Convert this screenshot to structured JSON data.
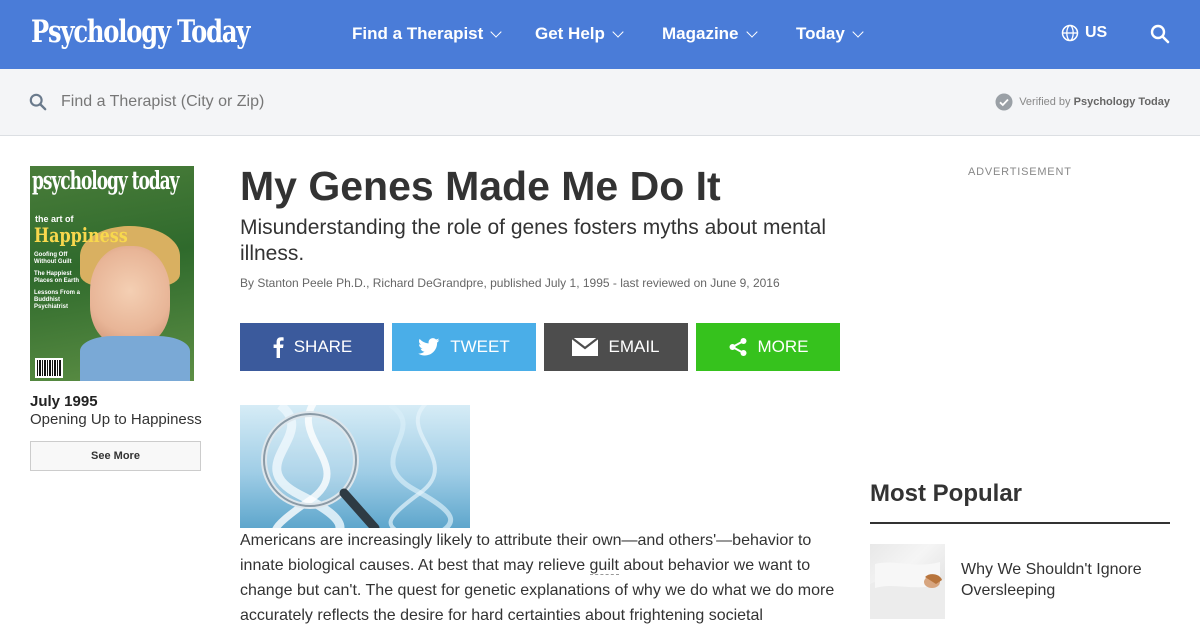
{
  "site": {
    "logo": "Psychology Today",
    "nav": [
      {
        "label": "Find a Therapist"
      },
      {
        "label": "Get Help"
      },
      {
        "label": "Magazine"
      },
      {
        "label": "Today"
      }
    ],
    "region": "US"
  },
  "search": {
    "placeholder": "Find a Therapist (City or Zip)",
    "verified_prefix": "Verified by",
    "verified_by": "Psychology Today"
  },
  "issue": {
    "cover_masthead": "psychology today",
    "cover_kicker": "the art of",
    "cover_headline": "Happiness",
    "cover_blurbs": [
      "Goofing Off Without Guilt",
      "The Happiest Places on Earth",
      "Lessons From a Buddhist Psychiatrist"
    ],
    "date": "July 1995",
    "title": "Opening Up to Happiness",
    "see_more": "See More"
  },
  "article": {
    "title": "My Genes Made Me Do It",
    "subtitle": "Misunderstanding the role of genes fosters myths about mental illness.",
    "byline": "By Stanton Peele Ph.D., Richard DeGrandpre, published July 1, 1995 - last reviewed on June 9, 2016",
    "share": {
      "facebook": "SHARE",
      "twitter": "TWEET",
      "email": "EMAIL",
      "more": "MORE"
    },
    "body_before": "Americans are increasingly likely to attribute their own—and others'—behavior to innate biological causes. At best that may relieve ",
    "body_link": "guilt",
    "body_after": " about behavior we want to change but can't. The quest for genetic explanations of why we do what we do more accurately reflects the desire for hard certainties about frightening societal"
  },
  "sidebar": {
    "ad_label": "ADVERTISEMENT",
    "popular_heading": "Most Popular",
    "popular": [
      {
        "title": "Why We Shouldn't Ignore Oversleeping"
      }
    ]
  },
  "colors": {
    "nav_bg": "#4a7cd8",
    "facebook": "#3b5a9c",
    "twitter": "#4aaee8",
    "email": "#4d4d4d",
    "more": "#36c21d"
  }
}
